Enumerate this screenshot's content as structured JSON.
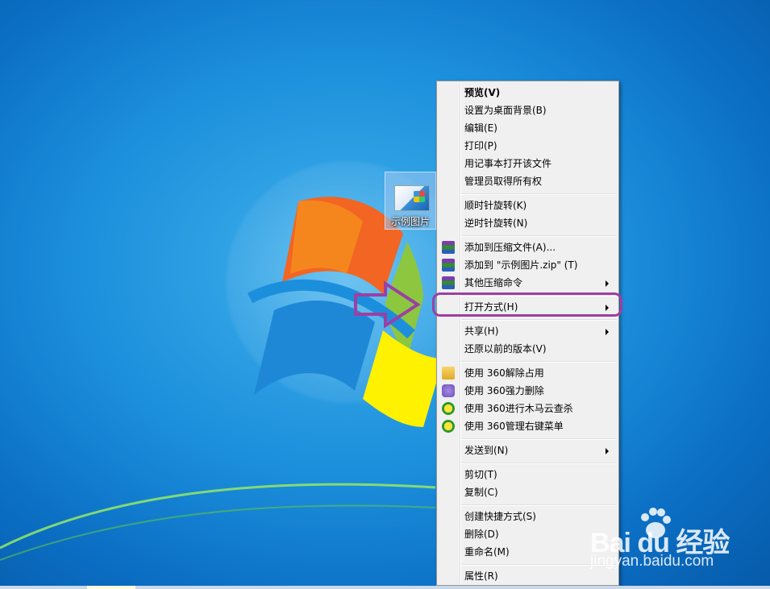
{
  "desktop": {
    "icon_label": "示例图片"
  },
  "context_menu": {
    "items": [
      {
        "label": "预览(V)",
        "bold": true
      },
      {
        "label": "设置为桌面背景(B)"
      },
      {
        "label": "编辑(E)"
      },
      {
        "label": "打印(P)"
      },
      {
        "label": "用记事本打开该文件"
      },
      {
        "label": "管理员取得所有权"
      },
      {
        "label": "顺时针旋转(K)"
      },
      {
        "label": "逆时针旋转(N)"
      },
      {
        "label": "添加到压缩文件(A)...",
        "icon": "winrar-archive-icon"
      },
      {
        "label": "添加到 \"示例图片.zip\" (T)",
        "icon": "winrar-archive-icon"
      },
      {
        "label": "其他压缩命令",
        "icon": "winrar-archive-icon",
        "submenu": true
      },
      {
        "label": "打开方式(H)",
        "submenu": true,
        "highlighted_by_annotation": true
      },
      {
        "label": "共享(H)",
        "submenu": true
      },
      {
        "label": "还原以前的版本(V)"
      },
      {
        "label": "使用 360解除占用",
        "icon": "folder-lock-icon"
      },
      {
        "label": "使用 360强力删除",
        "icon": "shield-delete-icon"
      },
      {
        "label": "使用 360进行木马云查杀",
        "icon": "360-plus-icon"
      },
      {
        "label": "使用 360管理右键菜单",
        "icon": "360-plus-icon"
      },
      {
        "label": "发送到(N)",
        "submenu": true
      },
      {
        "label": "剪切(T)"
      },
      {
        "label": "复制(C)"
      },
      {
        "label": "创建快捷方式(S)"
      },
      {
        "label": "删除(D)"
      },
      {
        "label": "重命名(M)"
      },
      {
        "label": "属性(R)"
      }
    ]
  },
  "annotation": {
    "color": "#9d3fa3"
  },
  "watermark": {
    "brand": "Bai du 经验",
    "url": "jingyan.baidu.com"
  }
}
